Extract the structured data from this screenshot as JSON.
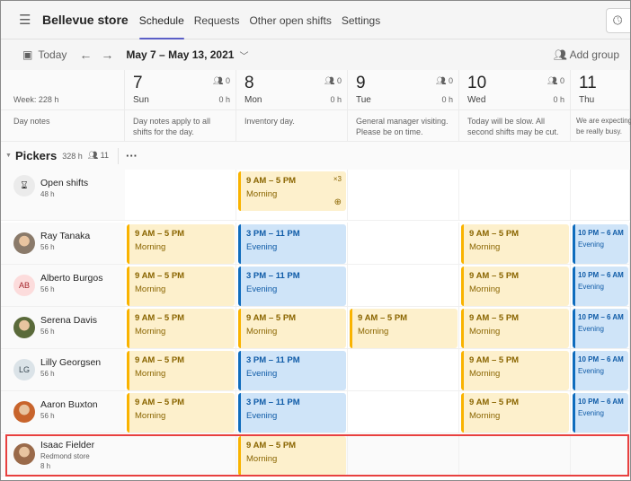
{
  "header": {
    "title": "Bellevue store",
    "tabs": [
      {
        "label": "Schedule",
        "active": true
      },
      {
        "label": "Requests"
      },
      {
        "label": "Other open shifts"
      },
      {
        "label": "Settings"
      }
    ],
    "icons": [
      "menu-icon",
      "clock-icon"
    ]
  },
  "toolbar": {
    "today": "Today",
    "range": "May 7 – May 13, 2021",
    "add_group": "Add group"
  },
  "week_label": "Week: 228 h",
  "day_notes_label": "Day notes",
  "days": [
    {
      "num": "7",
      "name": "Sun",
      "count": "0",
      "hours": "0 h",
      "note": "Day notes apply to all\nshifts for the day."
    },
    {
      "num": "8",
      "name": "Mon",
      "count": "0",
      "hours": "0 h",
      "note": "Inventory day."
    },
    {
      "num": "9",
      "name": "Tue",
      "count": "0",
      "hours": "0 h",
      "note": "General manager visiting.\nPlease be on time."
    },
    {
      "num": "10",
      "name": "Wed",
      "count": "0",
      "hours": "0 h",
      "note": "Today will be slow. All\nsecond shifts may be cut."
    },
    {
      "num": "11",
      "name": "Thu",
      "count": "",
      "hours": "",
      "note": "We are expecting\nbe really busy."
    }
  ],
  "group": {
    "name": "Pickers",
    "hours": "328 h",
    "members": "11",
    "more": "···"
  },
  "colors": {
    "morning_accent": "#f9b300",
    "evening_accent": "#0f6cbd",
    "tab_accent": "#5b5fc7",
    "highlight": "#e8403f"
  },
  "rows": [
    {
      "name": "Open shifts",
      "sub": "48 h",
      "avatar": "open-shifts-icon",
      "open": true,
      "shifts": [
        null,
        {
          "time": "9 AM – 5 PM",
          "label": "Morning",
          "type": "morning",
          "mult": "×3"
        },
        null,
        null,
        null
      ]
    },
    {
      "name": "Ray Tanaka",
      "sub": "56 h",
      "avatar": "photo",
      "avatar_color": "#8a7a6a",
      "shifts": [
        {
          "time": "9 AM – 5 PM",
          "label": "Morning",
          "type": "morning"
        },
        {
          "time": "3 PM – 11 PM",
          "label": "Evening",
          "type": "evening"
        },
        null,
        {
          "time": "9 AM – 5 PM",
          "label": "Morning",
          "type": "morning"
        },
        {
          "time": "10 PM – 6 AM",
          "label": "Evening",
          "type": "evening"
        }
      ]
    },
    {
      "name": "Alberto Burgos",
      "sub": "56 h",
      "avatar": "AB",
      "avatar_color": "#fcdcdc",
      "avatar_text_color": "#a4262c",
      "shifts": [
        {
          "time": "9 AM – 5 PM",
          "label": "Morning",
          "type": "morning"
        },
        {
          "time": "3 PM – 11 PM",
          "label": "Evening",
          "type": "evening"
        },
        null,
        {
          "time": "9 AM – 5 PM",
          "label": "Morning",
          "type": "morning"
        },
        {
          "time": "10 PM – 6 AM",
          "label": "Evening",
          "type": "evening"
        }
      ]
    },
    {
      "name": "Serena Davis",
      "sub": "56 h",
      "avatar": "photo",
      "avatar_color": "#5a6a3a",
      "shifts": [
        {
          "time": "9 AM – 5 PM",
          "label": "Morning",
          "type": "morning"
        },
        {
          "time": "9 AM – 5 PM",
          "label": "Morning",
          "type": "morning"
        },
        {
          "time": "9 AM – 5 PM",
          "label": "Morning",
          "type": "morning"
        },
        {
          "time": "9 AM – 5 PM",
          "label": "Morning",
          "type": "morning"
        },
        {
          "time": "10 PM – 6 AM",
          "label": "Evening",
          "type": "evening"
        }
      ]
    },
    {
      "name": "Lilly Georgsen",
      "sub": "56 h",
      "avatar": "LG",
      "avatar_color": "#dbe3e8",
      "avatar_text_color": "#3b4a54",
      "shifts": [
        {
          "time": "9 AM – 5 PM",
          "label": "Morning",
          "type": "morning"
        },
        {
          "time": "3 PM – 11 PM",
          "label": "Evening",
          "type": "evening"
        },
        null,
        {
          "time": "9 AM – 5 PM",
          "label": "Morning",
          "type": "morning"
        },
        {
          "time": "10 PM – 6 AM",
          "label": "Evening",
          "type": "evening"
        }
      ]
    },
    {
      "name": "Aaron Buxton",
      "sub": "56 h",
      "avatar": "photo",
      "avatar_color": "#c8642c",
      "shifts": [
        {
          "time": "9 AM – 5 PM",
          "label": "Morning",
          "type": "morning"
        },
        {
          "time": "3 PM – 11 PM",
          "label": "Evening",
          "type": "evening"
        },
        null,
        {
          "time": "9 AM – 5 PM",
          "label": "Morning",
          "type": "morning"
        },
        {
          "time": "10 PM – 6 AM",
          "label": "Evening",
          "type": "evening"
        }
      ]
    },
    {
      "name": "Isaac Fielder",
      "sub": "Redmond store",
      "sub2": "8 h",
      "avatar": "photo",
      "avatar_color": "#9a6a4a",
      "shifts": [
        null,
        {
          "time": "9 AM – 5 PM",
          "label": "Morning",
          "type": "morning"
        },
        null,
        null,
        null
      ]
    }
  ]
}
